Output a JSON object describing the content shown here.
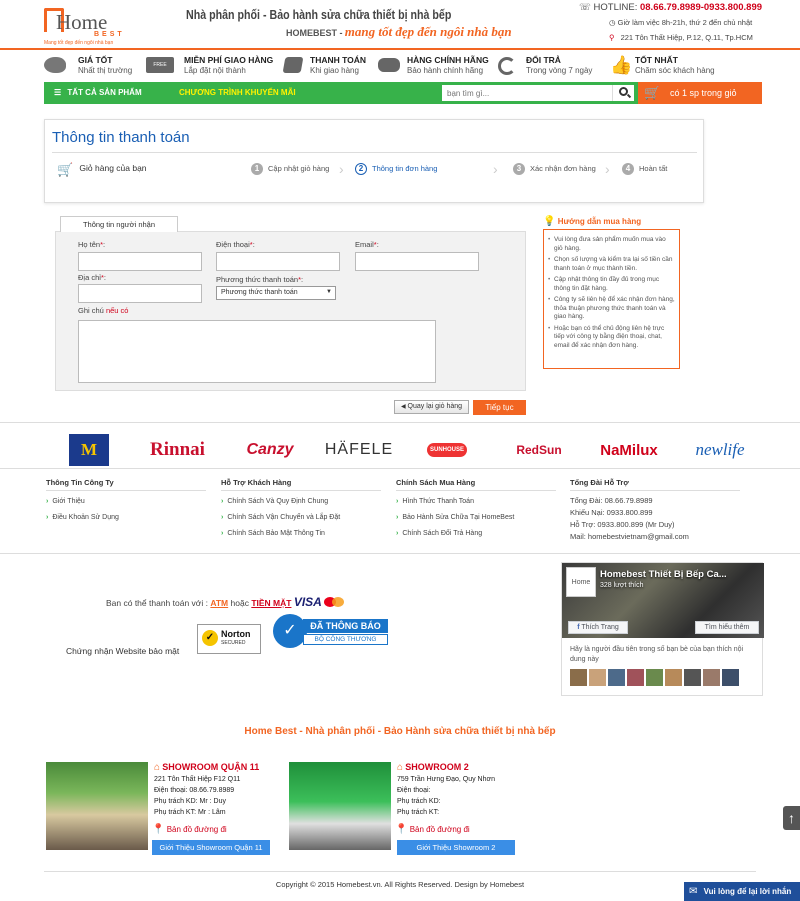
{
  "header": {
    "logo_text": "Home",
    "logo_sub": "BEST",
    "logo_tagline": "Mang tốt đẹp đến ngôi nhà bạn",
    "slogan1": "Nhà phân phối - Bảo hành sửa chữa thiết bị nhà bếp",
    "slogan2_brand": "HOMEBEST -",
    "slogan2_tag": "mang tốt đẹp đến ngôi nhà bạn",
    "hotline_label": "HOTLINE:",
    "hotline_number": "08.66.79.8989-0933.800.899",
    "hours": "Giờ làm việc 8h-21h, thứ 2 đến chủ nhật",
    "address": "221 Tôn Thất Hiệp, P.12, Q.11, Tp.HCM"
  },
  "features": [
    {
      "title": "GIÁ TỐT",
      "sub": "Nhất thị trường",
      "icon": "piggy-bank-icon"
    },
    {
      "title": "MIỄN PHÍ GIAO HÀNG",
      "sub": "Lắp đặt nội thành",
      "icon": "free-truck-icon"
    },
    {
      "title": "THANH TOÁN",
      "sub": "Khi giao hàng",
      "icon": "payment-icon"
    },
    {
      "title": "HÀNG CHÍNH HÃNG",
      "sub": "Bảo hành chính hãng",
      "icon": "handshake-icon"
    },
    {
      "title": "ĐỔI TRẢ",
      "sub": "Trong vòng 7 ngày",
      "icon": "refresh-icon"
    },
    {
      "title": "TỐT NHẤT",
      "sub": "Chăm sóc khách hàng",
      "icon": "thumbs-up-icon"
    }
  ],
  "nav": {
    "all_products": "TẤT CẢ SẢN PHẨM",
    "promotions": "CHƯƠNG TRÌNH KHUYẾN MÃI",
    "search_placeholder": "bạn tìm gì...",
    "cart": "có 1 sp trong giỏ"
  },
  "checkout": {
    "title": "Thông tin thanh toán",
    "cart_label": "Giỏ hàng của bạn",
    "steps": [
      {
        "num": "1",
        "label": "Cập nhật giỏ hàng"
      },
      {
        "num": "2",
        "label": "Thông tin đơn hàng"
      },
      {
        "num": "3",
        "label": "Xác nhận đơn hàng"
      },
      {
        "num": "4",
        "label": "Hoàn tất"
      }
    ]
  },
  "form": {
    "tab": "Thông tin người nhận",
    "name_label": "Họ tên",
    "phone_label": "Điện thoại",
    "email_label": "Email",
    "address_label": "Địa chỉ",
    "payment_label": "Phương thức thanh toán",
    "payment_value": "Phương thức thanh toán",
    "note_label": "Ghi chú",
    "note_hint": "nếu có",
    "required_mark": "*",
    "colon": ":",
    "back_button": "Quay lại giỏ hàng",
    "next_button": "Tiếp tục"
  },
  "guide": {
    "title": "Hướng dẫn mua hàng",
    "items": [
      "Vui lòng đưa sản phẩm muốn mua vào giỏ hàng.",
      "Chọn số lượng và kiểm tra lại số tiền cần thanh toán ở mục thành tiền.",
      "Cập nhật thông tin đầy đủ trong mục thông tin đặt hàng.",
      "Công ty sẽ liên hệ để xác nhận đơn hàng, thỏa thuận phương thức thanh toán và giao hàng.",
      "Hoặc bạn có thể chủ động liên hệ trực tiếp với công ty bằng điện thoại, chat, email để xác nhận đơn hàng."
    ]
  },
  "brands": [
    "M",
    "Rinnai",
    "Canzy",
    "HÄFELE",
    "SUNHOUSE",
    "RedSun",
    "NaMilux",
    "newlife"
  ],
  "footer": {
    "col1_title": "Thông Tin Công Ty",
    "col1": [
      "Giới Thiệu",
      "Điều Khoản Sử Dụng"
    ],
    "col2_title": "Hỗ Trợ Khách Hàng",
    "col2": [
      "Chính Sách Và Quy Định Chung",
      "Chính Sách Vận Chuyển và Lắp Đặt",
      "Chính Sách Bảo Mật Thông Tin"
    ],
    "col3_title": "Chính Sách Mua Hàng",
    "col3": [
      "Hình Thức Thanh Toán",
      "Bảo Hành Sửa Chữa Tại HomeBest",
      "Chính Sách Đổi Trả Hàng"
    ],
    "col4_title": "Tổng Đài Hỗ Trợ",
    "col4": [
      "Tổng Đài: 08.66.79.8989",
      "Khiếu Nại: 0933.800.899",
      "Hỗ Trợ: 0933.800.899 (Mr Duy)",
      "Mail: homebestvietnam@gmail.com"
    ]
  },
  "payment": {
    "text_prefix": "Ban có thể thanh toán với :",
    "atm": "ATM",
    "or": "hoặc",
    "cash": "TIỀN MẶT",
    "visa": "VISA",
    "security_label": "Chứng nhận Website bảo mật",
    "norton": "Norton",
    "norton_sub": "SECURED",
    "bct_line1": "ĐÃ THÔNG BÁO",
    "bct_line2": "BỘ CÔNG THƯƠNG"
  },
  "facebook": {
    "page_name": "Homebest Thiết Bị Bếp Ca...",
    "likes": "328 lượt thích",
    "like_button": "Thích Trang",
    "more_button": "Tìm hiểu thêm",
    "friends_text": "Hãy là người đầu tiên trong số bạn bè của bạn thích nội dung này"
  },
  "showroom_title": "Home Best - Nhà phân phối - Bảo Hành sửa chữa thiết bị nhà bếp",
  "showrooms": [
    {
      "name": "SHOWROOM QUẬN 11",
      "lines": [
        "221 Tôn Thất Hiệp F12 Q11",
        "Điện thoại: 08.66.79.8989",
        "Phụ trách KD: Mr : Duy",
        "Phụ trách KT: Mr : Lâm"
      ],
      "map": "Bản đồ đường đi",
      "button": "Giới Thiệu Showroom Quận 11"
    },
    {
      "name": "SHOWROOM 2",
      "lines": [
        "759 Trần Hưng Đạo, Quy Nhơn",
        "Điện thoại:",
        "Phụ trách KD:",
        "Phụ trách KT:"
      ],
      "map": "Bản đồ đường đi",
      "button": "Giới Thiệu Showroom 2"
    }
  ],
  "copyright": "Copyright © 2015 Homebest.vn. All Rights Reserved. Design by Homebest",
  "chat_button": "Vui lòng để lại lời nhắn",
  "scroll_top": "↑",
  "colors": {
    "accent": "#f26522",
    "green": "#37b24a",
    "blue": "#1a5fb4"
  }
}
